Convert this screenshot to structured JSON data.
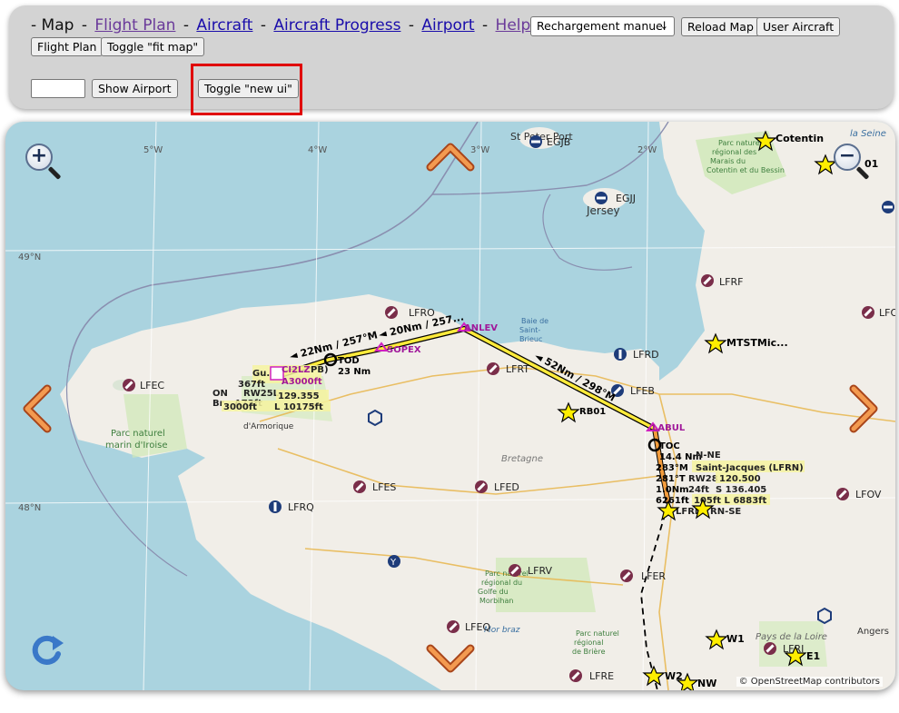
{
  "nav": {
    "current": "Map",
    "links": [
      {
        "label": "Flight Plan",
        "visited": true
      },
      {
        "label": "Aircraft",
        "visited": false
      },
      {
        "label": "Aircraft Progress",
        "visited": false
      },
      {
        "label": "Airport",
        "visited": false
      },
      {
        "label": "Help",
        "visited": true
      }
    ]
  },
  "toolbar": {
    "reload_mode_selected": "Rechargement manuel",
    "reload_map": "Reload Map",
    "user_aircraft": "User Aircraft",
    "flight_plan": "Flight Plan",
    "toggle_fit_map": "Toggle \"fit map\"",
    "airport_input_value": "",
    "show_airport": "Show Airport",
    "toggle_new_ui": "Toggle \"new ui\""
  },
  "map": {
    "zoom_in": "+",
    "zoom_out": "−",
    "attribution": "© OpenStreetMap contributors",
    "graticule": {
      "lon": [
        "5°W",
        "4°W",
        "3°W",
        "2°W"
      ],
      "lat": [
        "49°N",
        "48°N"
      ]
    },
    "places": [
      {
        "name": "St Peter Port"
      },
      {
        "name": "Jersey"
      },
      {
        "name": "Cotentin"
      },
      {
        "name": "Parc naturel régional des Marais du Cotentin et du Bessin"
      },
      {
        "name": "la Seine"
      },
      {
        "name": "Baie de Saint-Brieuc"
      },
      {
        "name": "Bretagne"
      },
      {
        "name": "Parc naturel marin d'Iroise"
      },
      {
        "name": "d'Armorique"
      },
      {
        "name": "Parc naturel régional du Golfe du Morbihan"
      },
      {
        "name": "Mor braz"
      },
      {
        "name": "Parc naturel régional de Brière"
      },
      {
        "name": "Pays de la Loire"
      },
      {
        "name": "Angers"
      }
    ],
    "airports": [
      "EGJB",
      "EGJJ",
      "LFRO",
      "LFRF",
      "LFRT",
      "LFRD",
      "LFEB",
      "LFEC",
      "LFES",
      "LFED",
      "LFRQ",
      "LFRV",
      "LFER",
      "LFEQ",
      "LFRE",
      "LFOV",
      "LFO",
      "LFRI",
      "LFRN",
      "LFRB"
    ],
    "waypoints": [
      "Cotentin",
      "01",
      "MTSTMic...",
      "RB01",
      "W1",
      "W2",
      "NW",
      "E1"
    ],
    "route_points": [
      "SOPEX",
      "ANLEV",
      "LABUL",
      "CI2LZ",
      "A3000ft"
    ],
    "legs": [
      "22Nm / 257°M",
      "20Nm / 257...",
      "52Nm / 298°M"
    ],
    "markers": {
      "tod": {
        "label": "TOD",
        "dist": "23 Nm"
      },
      "toc": {
        "label": "TOC",
        "dist": "14.4 Nm",
        "hdg1": "283°M",
        "hdg2": "281°T",
        "d2": "1.0Nm",
        "alt": "6261ft"
      }
    },
    "dest_info": {
      "line1": "Gu...",
      "line2": "367ft",
      "line3": "RW25L",
      "line4": "A73ft",
      "line5": "3000ft",
      "freq": "129.355",
      "rwy": "L 10175ft",
      "o": "ON",
      "b": "Br"
    },
    "lfrn_info": {
      "ne": "N-NE",
      "name": "Saint-Jacques (LFRN)",
      "rw": "RW28",
      "freq": "120.500",
      "len": "24ft",
      "s": "S 136.405",
      "rwy": "105ft L 6883ft",
      "se": "RN-SE"
    }
  }
}
